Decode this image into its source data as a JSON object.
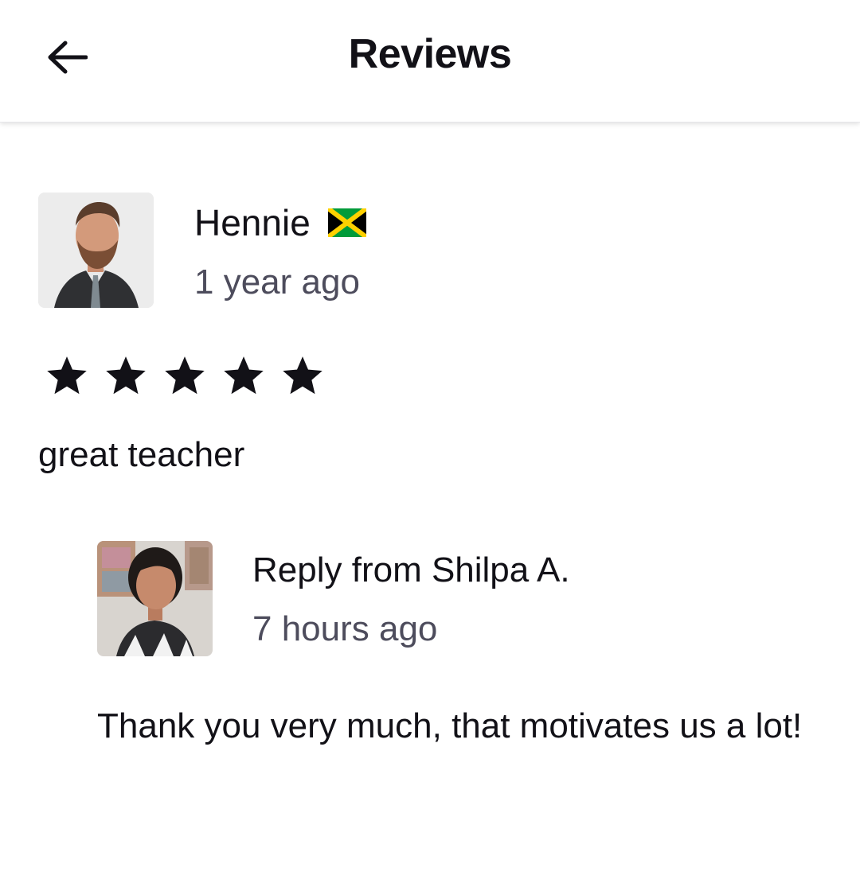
{
  "header": {
    "title": "Reviews",
    "back_icon": "arrow-left-icon"
  },
  "review": {
    "author": "Hennie",
    "country_flag": "jamaica-flag-icon",
    "time_ago": "1 year ago",
    "rating": 5,
    "rating_max": 5,
    "text": "great teacher",
    "reply": {
      "author_label": "Reply from Shilpa A.",
      "time_ago": "7 hours ago",
      "text": "Thank you very much, that motivates us a lot!"
    }
  },
  "colors": {
    "text_primary": "#121117",
    "text_secondary": "#4d4c5c",
    "flag_green": "#009b3a",
    "flag_gold": "#fed100",
    "flag_black": "#000000"
  }
}
